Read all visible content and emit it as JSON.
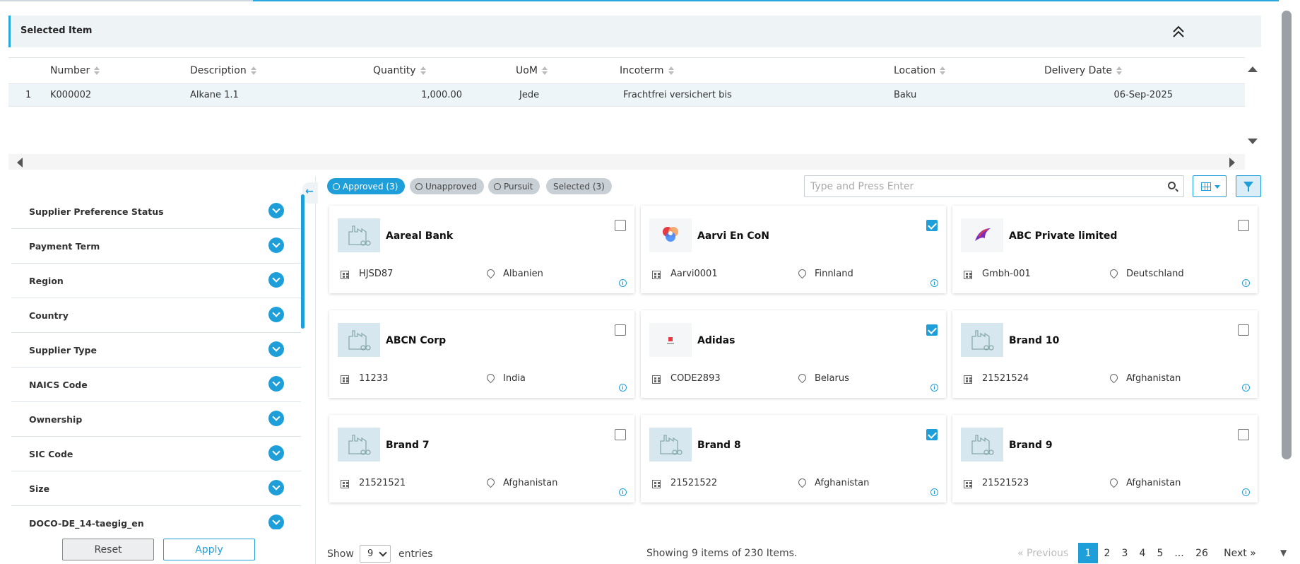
{
  "selected_item": {
    "title": "Selected Item",
    "columns": [
      "Number",
      "Description",
      "Quantity",
      "UoM",
      "Incoterm",
      "Location",
      "Delivery Date"
    ],
    "rows": [
      {
        "index": "1",
        "number": "K000002",
        "description": "Alkane 1.1",
        "quantity": "1,000.00",
        "uom": "Jede",
        "incoterm": "Frachtfrei versichert bis",
        "location": "Baku",
        "delivery_date": "06-Sep-2025"
      }
    ]
  },
  "filters": {
    "items": [
      "Supplier Preference Status",
      "Payment Term",
      "Region",
      "Country",
      "Supplier Type",
      "NAICS Code",
      "Ownership",
      "SIC Code",
      "Size",
      "DOCO-DE_14-taegig_en"
    ],
    "reset_label": "Reset",
    "apply_label": "Apply"
  },
  "chips": [
    {
      "label": "Approved (3)",
      "active": true
    },
    {
      "label": "Unapproved",
      "active": false
    },
    {
      "label": "Pursuit",
      "active": false
    },
    {
      "label": "Selected (3)",
      "active": false
    }
  ],
  "search": {
    "placeholder": "Type and Press Enter"
  },
  "suppliers": [
    {
      "name": "Aareal Bank",
      "code": "HJSD87",
      "location": "Albanien",
      "checked": false,
      "logo": "factory-icon"
    },
    {
      "name": "Aarvi En CoN",
      "code": "Aarvi0001",
      "location": "Finnland",
      "checked": true,
      "logo": "company-logo"
    },
    {
      "name": "ABC Private limited",
      "code": "Gmbh-001",
      "location": "Deutschland",
      "checked": false,
      "logo": "bird-logo"
    },
    {
      "name": "ABCN Corp",
      "code": "11233",
      "location": "India",
      "checked": false,
      "logo": "factory-icon"
    },
    {
      "name": "Adidas",
      "code": "CODE2893",
      "location": "Belarus",
      "checked": true,
      "logo": "small-logo"
    },
    {
      "name": "Brand 10",
      "code": "21521524",
      "location": "Afghanistan",
      "checked": false,
      "logo": "factory-icon"
    },
    {
      "name": "Brand 7",
      "code": "21521521",
      "location": "Afghanistan",
      "checked": false,
      "logo": "factory-icon"
    },
    {
      "name": "Brand 8",
      "code": "21521522",
      "location": "Afghanistan",
      "checked": true,
      "logo": "factory-icon"
    },
    {
      "name": "Brand 9",
      "code": "21521523",
      "location": "Afghanistan",
      "checked": false,
      "logo": "factory-icon"
    }
  ],
  "footer": {
    "show_label": "Show",
    "page_size": "9",
    "entries_label": "entries",
    "showing_text": "Showing 9 items of 230 Items.",
    "prev_label": "« Previous",
    "pages": [
      "1",
      "2",
      "3",
      "4",
      "5",
      "...",
      "26"
    ],
    "current_page": "1",
    "next_label": "Next »"
  },
  "colors": {
    "accent": "#1f9fd9",
    "chip_inactive": "#c9d0d5",
    "header_bg": "#eef3f6"
  }
}
